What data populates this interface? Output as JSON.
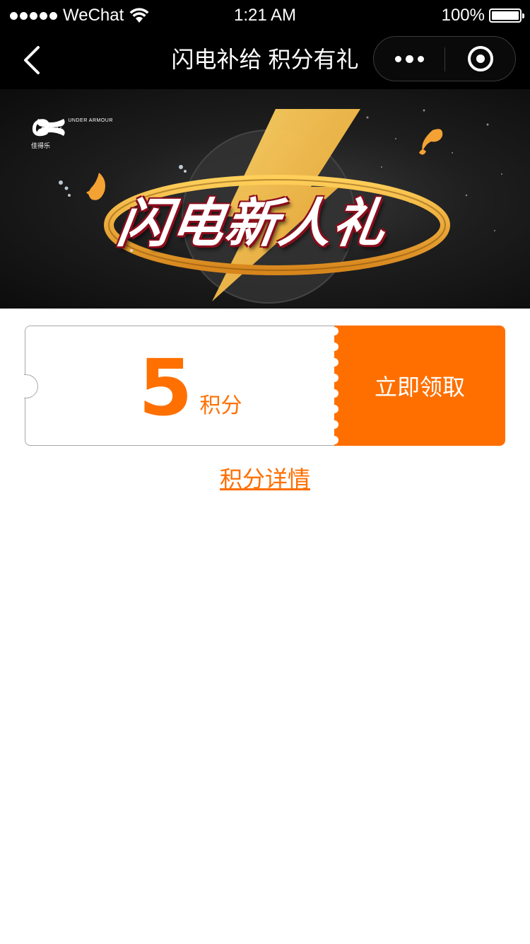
{
  "status_bar": {
    "carrier": "WeChat",
    "time": "1:21 AM",
    "battery": "100%"
  },
  "nav": {
    "title": "闪电补给 积分有礼"
  },
  "banner": {
    "brand_g": "G",
    "brand_g_sub": "佳得乐",
    "brand_times": "×",
    "brand_ua_text": "UNDER ARMOUR",
    "headline": "闪电新人礼"
  },
  "coupon": {
    "points": "5",
    "unit": "积分",
    "claim_label": "立即领取"
  },
  "detail_link": "积分详情",
  "colors": {
    "accent": "#ff6f00",
    "bar": "#000000"
  }
}
